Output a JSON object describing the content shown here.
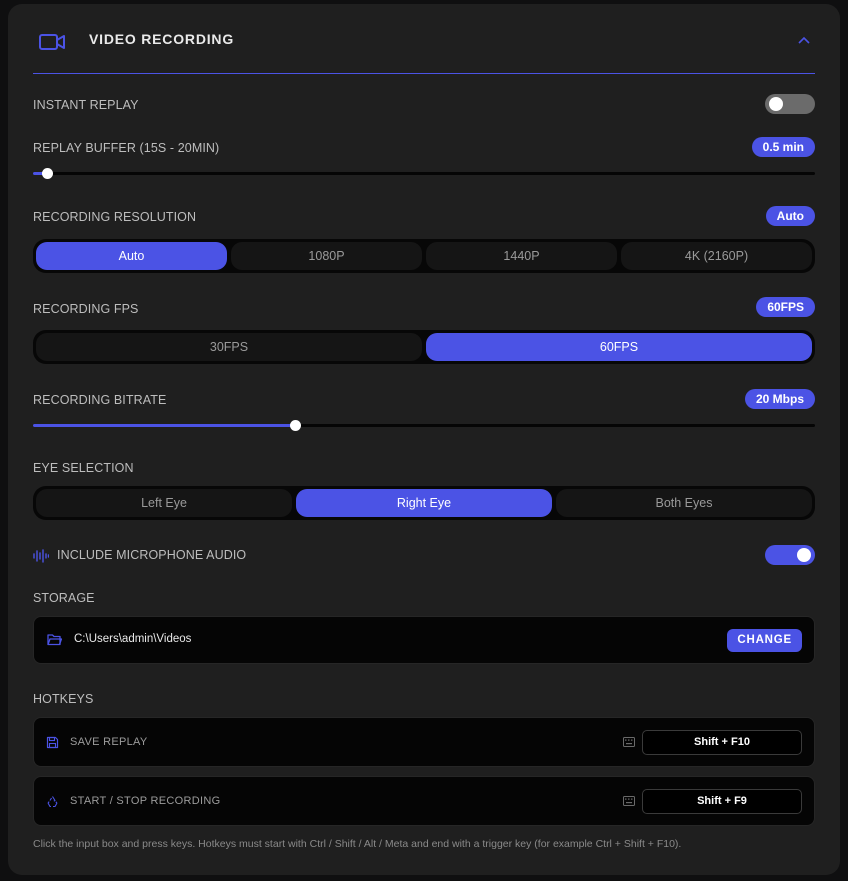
{
  "header": {
    "title": "VIDEO RECORDING"
  },
  "instant_replay": {
    "label": "INSTANT REPLAY",
    "enabled": false
  },
  "replay_buffer": {
    "label": "REPLAY BUFFER (15S - 20MIN)",
    "value_label": "0.5 min",
    "value_minutes": 0.5,
    "min_minutes": 0.25,
    "max_minutes": 20
  },
  "resolution": {
    "label": "RECORDING RESOLUTION",
    "badge": "Auto",
    "options": [
      "Auto",
      "1080P",
      "1440P",
      "4K (2160P)"
    ],
    "selected": "Auto"
  },
  "fps": {
    "label": "RECORDING FPS",
    "badge": "60FPS",
    "options": [
      "30FPS",
      "60FPS"
    ],
    "selected": "60FPS"
  },
  "bitrate": {
    "label": "RECORDING BITRATE",
    "badge": "20 Mbps",
    "level_fraction": 0.335
  },
  "eye": {
    "label": "EYE SELECTION",
    "options": [
      "Left Eye",
      "Right Eye",
      "Both Eyes"
    ],
    "selected": "Right Eye"
  },
  "microphone": {
    "label": "INCLUDE MICROPHONE AUDIO",
    "enabled": true
  },
  "storage": {
    "label": "STORAGE",
    "path": "C:\\Users\\admin\\Videos",
    "change_label": "CHANGE"
  },
  "hotkeys": {
    "label": "HOTKEYS",
    "items": [
      {
        "label": "SAVE REPLAY",
        "keys": "Shift + F10"
      },
      {
        "label": "START / STOP RECORDING",
        "keys": "Shift + F9"
      }
    ],
    "note": "Click the input box and press keys. Hotkeys must start with Ctrl / Shift / Alt / Meta and end with a trigger key (for example Ctrl + Shift + F10)."
  },
  "colors": {
    "accent": "#4b53e5",
    "panel": "#1f1f1f",
    "track": "#050505"
  }
}
